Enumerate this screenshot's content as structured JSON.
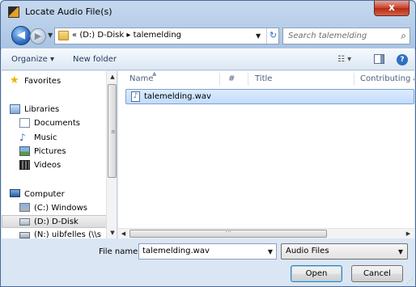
{
  "window": {
    "title": "Locate Audio File(s)",
    "close_label": "x"
  },
  "address": {
    "chevron": "«",
    "crumb_drive": "(D:) D-Disk",
    "crumb_sep": "▸",
    "crumb_folder": "talemelding"
  },
  "search": {
    "placeholder": "Search talemelding"
  },
  "toolbar": {
    "organize": "Organize ▾",
    "new_folder": "New folder",
    "help": "?"
  },
  "nav": {
    "favorites": "Favorites",
    "libraries": "Libraries",
    "documents": "Documents",
    "music": "Music",
    "pictures": "Pictures",
    "videos": "Videos",
    "computer": "Computer",
    "drive_c": "(C:) Windows",
    "drive_d": "(D:) D-Disk",
    "drive_n": "(N:) uibfelles (\\\\s"
  },
  "columns": {
    "name": "Name",
    "number": "#",
    "title": "Title",
    "contributing": "Contributing ar"
  },
  "files": [
    {
      "name": "talemelding.wav"
    }
  ],
  "form": {
    "file_name_label": "File name:",
    "file_name_value": "talemelding.wav",
    "file_type": "Audio Files",
    "open": "Open",
    "cancel": "Cancel"
  }
}
